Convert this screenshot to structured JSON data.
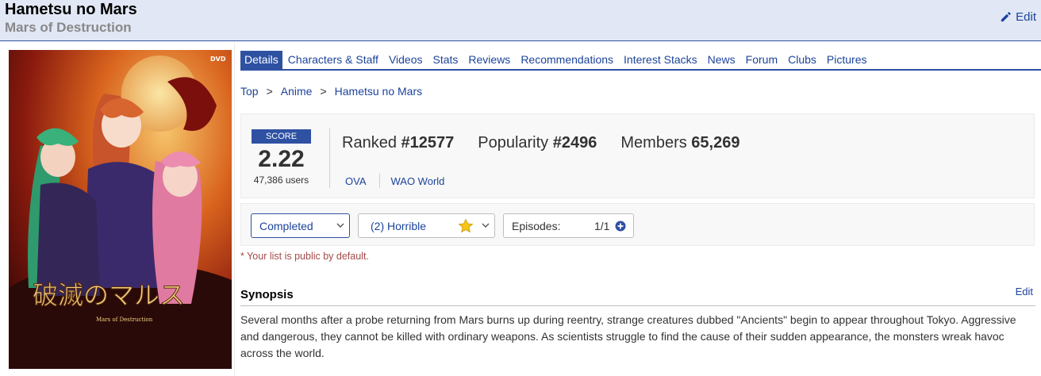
{
  "header": {
    "title": "Hametsu no Mars",
    "subtitle": "Mars of Destruction",
    "edit_label": "Edit"
  },
  "poster": {
    "title_art_text": "破滅のマルス",
    "subtitle_art_text": "Mars of Destruction",
    "corner_badge": "DVD"
  },
  "tabs": [
    {
      "label": "Details",
      "active": true
    },
    {
      "label": "Characters & Staff"
    },
    {
      "label": "Videos"
    },
    {
      "label": "Stats"
    },
    {
      "label": "Reviews"
    },
    {
      "label": "Recommendations"
    },
    {
      "label": "Interest Stacks"
    },
    {
      "label": "News"
    },
    {
      "label": "Forum"
    },
    {
      "label": "Clubs"
    },
    {
      "label": "Pictures"
    }
  ],
  "breadcrumb": [
    "Top",
    ">",
    "Anime",
    ">",
    "Hametsu no Mars"
  ],
  "score": {
    "label": "SCORE",
    "value": "2.22",
    "users": "47,386 users"
  },
  "stats": {
    "ranked_label": "Ranked",
    "ranked_value": "#12577",
    "popularity_label": "Popularity",
    "popularity_value": "#2496",
    "members_label": "Members",
    "members_value": "65,269"
  },
  "info": {
    "type": "OVA",
    "studio": "WAO World"
  },
  "list": {
    "status": "Completed",
    "score": "(2) Horrible",
    "episodes_label": "Episodes:",
    "episodes_value": "1/1",
    "public_note": "* Your list is public by default."
  },
  "synopsis": {
    "title": "Synopsis",
    "edit_label": "Edit",
    "text": "Several months after a probe returning from Mars burns up during reentry, strange creatures dubbed \"Ancients\" begin to appear throughout Tokyo. Aggressive and dangerous, they cannot be killed with ordinary weapons. As scientists struggle to find the cause of their sudden appearance, the monsters wreak havoc across the world."
  },
  "colors": {
    "accent": "#2e51a2",
    "link": "#1c439b",
    "header_bg": "#e1e7f5",
    "note": "#a54a4a"
  }
}
